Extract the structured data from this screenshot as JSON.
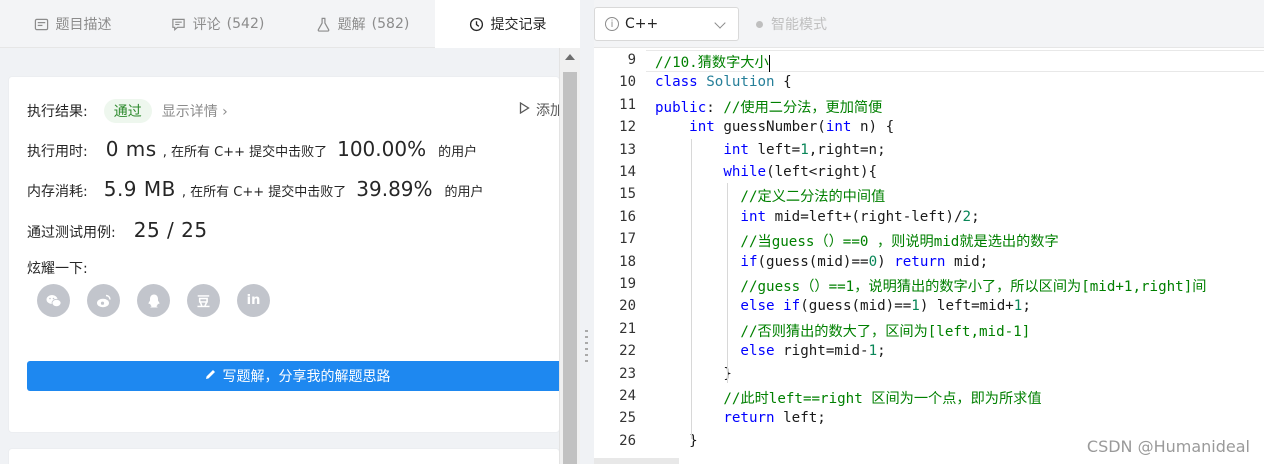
{
  "tabs": [
    {
      "label": "题目描述",
      "count": "",
      "icon": "description-icon"
    },
    {
      "label": "评论",
      "count": "(542)",
      "icon": "comment-icon"
    },
    {
      "label": "题解",
      "count": "(582)",
      "icon": "flask-icon"
    },
    {
      "label": "提交记录",
      "count": "",
      "icon": "history-icon"
    }
  ],
  "result": {
    "label": "执行结果:",
    "status": "通过",
    "detail": "显示详情",
    "add_note": "添加",
    "runtime_label": "执行用时:",
    "runtime_value": "0 ms",
    "runtime_text": ", 在所有 C++ 提交中击败了",
    "runtime_pct": "100.00%",
    "runtime_suffix": "的用户",
    "memory_label": "内存消耗:",
    "memory_value": "5.9 MB",
    "memory_text": ", 在所有 C++ 提交中击败了",
    "memory_pct": "39.89%",
    "memory_suffix": "的用户",
    "tests_label": "通过测试用例:",
    "tests_value": "25 / 25",
    "share_label": "炫耀一下:"
  },
  "share_icons": [
    "wechat-icon",
    "weibo-icon",
    "qq-icon",
    "douban-icon",
    "linkedin-icon"
  ],
  "share_glyphs": {
    "douban": "豆",
    "linkedin": "in"
  },
  "write_button": "写题解，分享我的解题思路",
  "toolbar": {
    "language": "C++",
    "info_glyph": "i",
    "smart_mode": "智能模式"
  },
  "code": {
    "line_numbers": [
      "9",
      "10",
      "11",
      "12",
      "13",
      "14",
      "15",
      "16",
      "17",
      "18",
      "19",
      "20",
      "21",
      "22",
      "23",
      "24",
      "25",
      "26"
    ],
    "lines": [
      "//10.猜数字大小",
      "class Solution {",
      "public: //使用二分法，更加简便",
      "    int guessNumber(int n) {",
      "        int left=1,right=n;",
      "        while(left<right){",
      "          //定义二分法的中间值",
      "          int mid=left+(right-left)/2;",
      "          //当guess（）==0 ，则说明mid就是选出的数字",
      "          if(guess(mid)==0) return mid;",
      "          //guess（）==1，说明猜出的数字小了，所以区间为[mid+1,right]间",
      "          else if(guess(mid)==1) left=mid+1;",
      "          //否则猜出的数大了，区间为[left,mid-1]",
      "          else right=mid-1;",
      "        }",
      "        //此时left==right 区间为一个点，即为所求值",
      "        return left;",
      "    }"
    ]
  },
  "watermark": "CSDN @Humanideal"
}
